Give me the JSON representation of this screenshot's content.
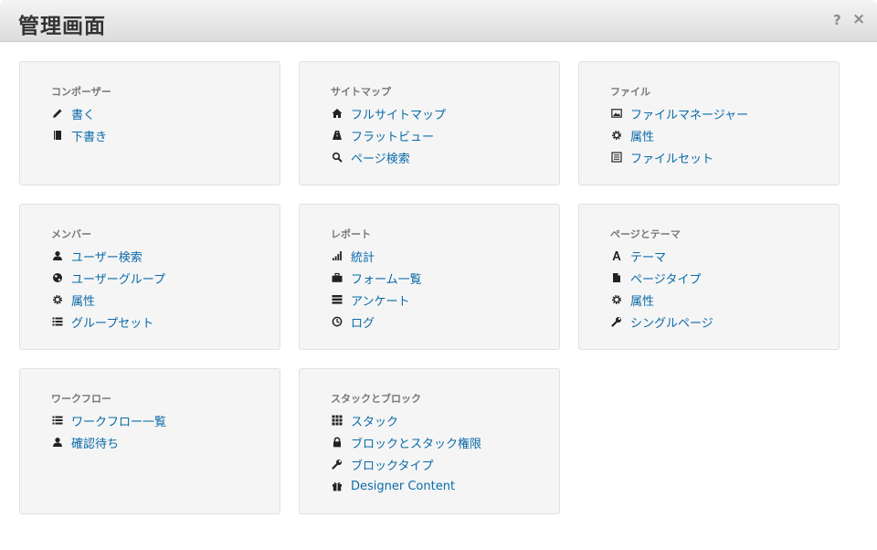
{
  "header": {
    "title": "管理画面",
    "help_label": "?",
    "close_label": "×"
  },
  "panels": [
    {
      "title": "コンポーザー",
      "items": [
        {
          "label": "書く",
          "icon": "pencil-icon"
        },
        {
          "label": "下書き",
          "icon": "book-icon"
        }
      ]
    },
    {
      "title": "サイトマップ",
      "items": [
        {
          "label": "フルサイトマップ",
          "icon": "home-icon"
        },
        {
          "label": "フラットビュー",
          "icon": "road-icon"
        },
        {
          "label": "ページ検索",
          "icon": "search-icon"
        }
      ]
    },
    {
      "title": "ファイル",
      "items": [
        {
          "label": "ファイルマネージャー",
          "icon": "picture-icon"
        },
        {
          "label": "属性",
          "icon": "cog-icon"
        },
        {
          "label": "ファイルセット",
          "icon": "list-alt-icon"
        }
      ]
    },
    {
      "title": "メンバー",
      "items": [
        {
          "label": "ユーザー検索",
          "icon": "user-icon"
        },
        {
          "label": "ユーザーグループ",
          "icon": "globe-icon"
        },
        {
          "label": "属性",
          "icon": "cog-icon"
        },
        {
          "label": "グループセット",
          "icon": "list-icon"
        }
      ]
    },
    {
      "title": "レポート",
      "items": [
        {
          "label": "統計",
          "icon": "signal-icon"
        },
        {
          "label": "フォーム一覧",
          "icon": "briefcase-icon"
        },
        {
          "label": "アンケート",
          "icon": "tasks-icon"
        },
        {
          "label": "ログ",
          "icon": "time-icon"
        }
      ]
    },
    {
      "title": "ページとテーマ",
      "items": [
        {
          "label": "テーマ",
          "icon": "font-icon"
        },
        {
          "label": "ページタイプ",
          "icon": "file-icon"
        },
        {
          "label": "属性",
          "icon": "cog-icon"
        },
        {
          "label": "シングルページ",
          "icon": "wrench-icon"
        }
      ]
    },
    {
      "title": "ワークフロー",
      "items": [
        {
          "label": "ワークフロー一覧",
          "icon": "list-icon"
        },
        {
          "label": "確認待ち",
          "icon": "user-icon"
        }
      ]
    },
    {
      "title": "スタックとブロック",
      "items": [
        {
          "label": "スタック",
          "icon": "th-icon"
        },
        {
          "label": "ブロックとスタック権限",
          "icon": "lock-icon"
        },
        {
          "label": "ブロックタイプ",
          "icon": "wrench-icon"
        },
        {
          "label": "Designer Content",
          "icon": "gift-icon"
        }
      ]
    }
  ]
}
